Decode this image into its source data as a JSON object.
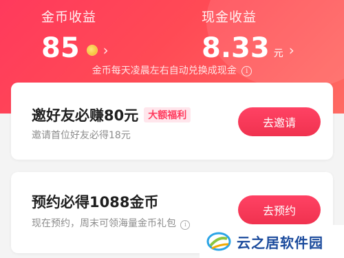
{
  "header": {
    "coin": {
      "label": "金币收益",
      "value": "85"
    },
    "cash": {
      "label": "现金收益",
      "value": "8.33",
      "unit": "元"
    },
    "note": "金币每天凌晨左右自动兑换成现金"
  },
  "cards": [
    {
      "title": "邀好友必赚80元",
      "badge": "大额福利",
      "subtitle": "邀请首位好友必得18元",
      "button": "去邀请"
    },
    {
      "title": "预约必得1088金币",
      "subtitle": "现在预约，周末可领海量金币礼包",
      "button": "去预约"
    }
  ],
  "watermark": {
    "text": "云之居软件园"
  },
  "colors": {
    "accent": "#ff3a5c",
    "badge_bg": "#ffe6ec",
    "watermark_text": "#1a4a9c"
  }
}
